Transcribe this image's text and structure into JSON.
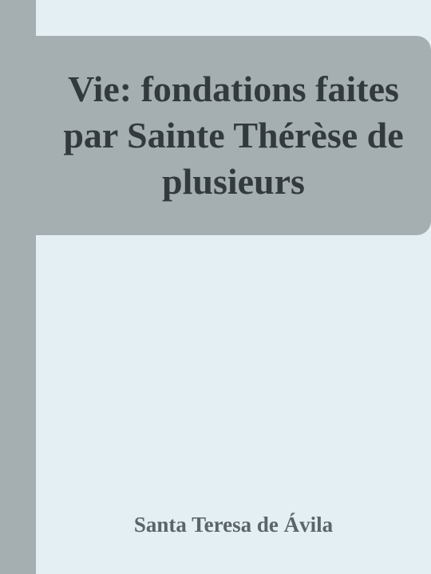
{
  "book": {
    "title": "Vie: fondations faites par Sainte Thérèse de plusieurs",
    "author": "Santa Teresa de Ávila"
  },
  "colors": {
    "background": "#e4eff4",
    "band": "#a5aeb0",
    "title_text": "#333a3d",
    "author_text": "#5b6569"
  }
}
